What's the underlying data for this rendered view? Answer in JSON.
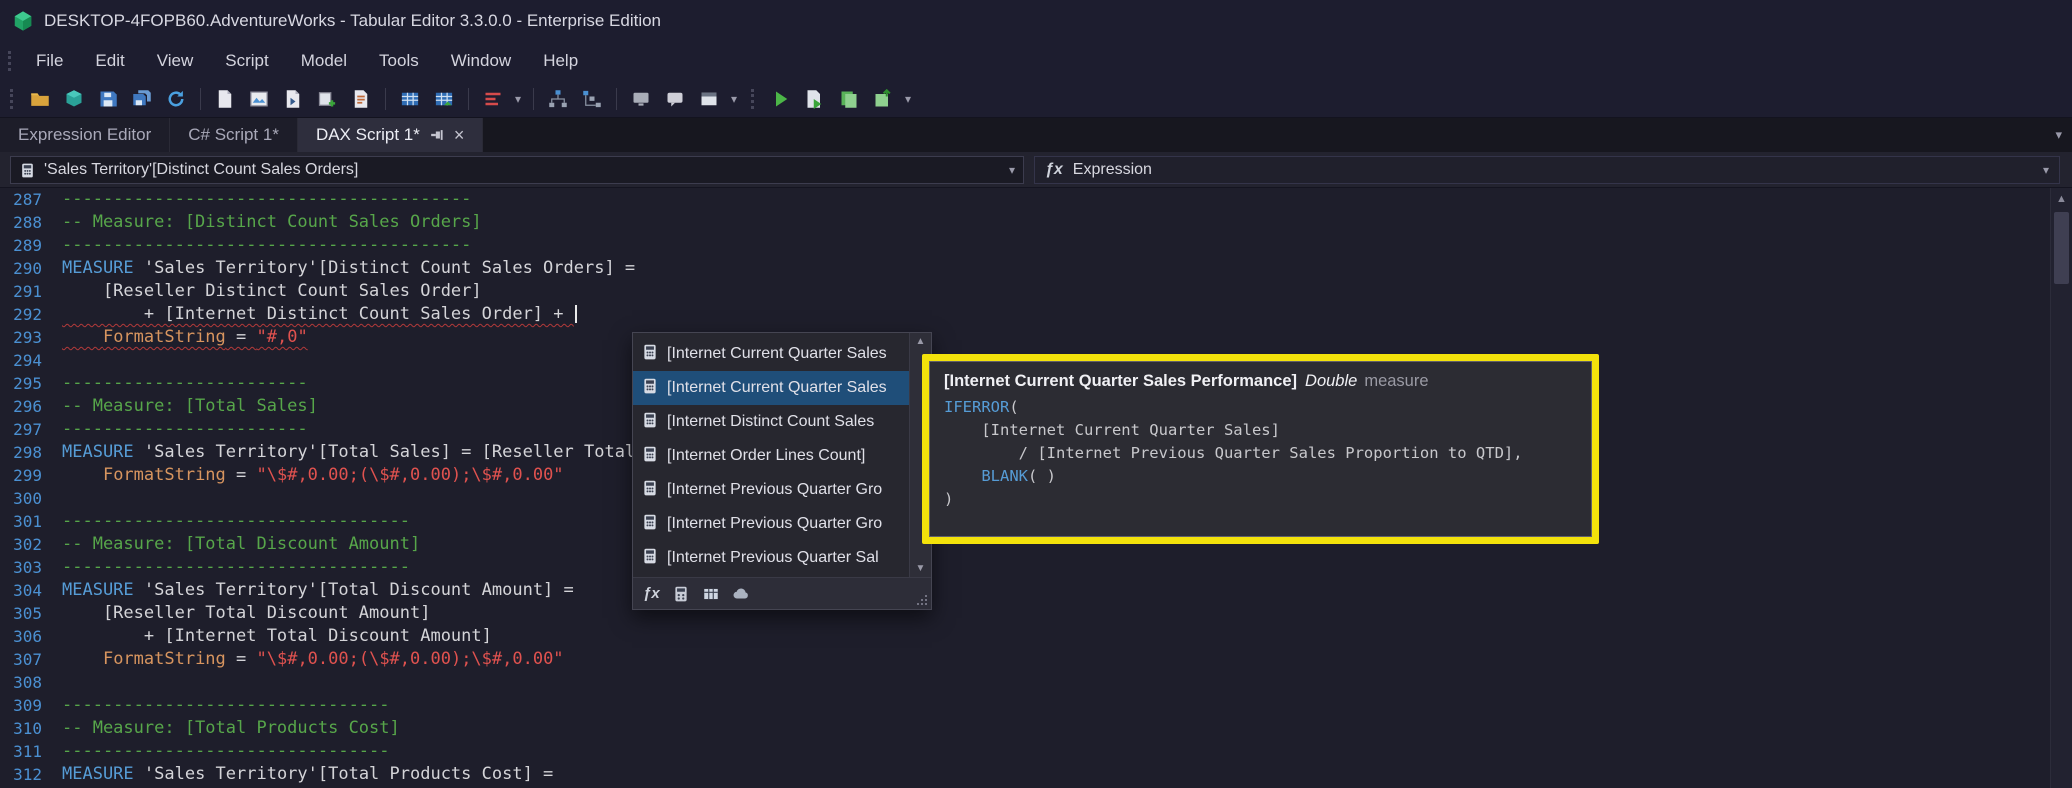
{
  "window": {
    "title": "DESKTOP-4FOPB60.AdventureWorks - Tabular Editor 3.3.0.0 - Enterprise Edition"
  },
  "menu": {
    "items": [
      "File",
      "Edit",
      "View",
      "Script",
      "Model",
      "Tools",
      "Window",
      "Help"
    ]
  },
  "toolbar": {
    "icons": [
      "folder-open",
      "model-cube",
      "save",
      "save-all",
      "refresh",
      "new-script",
      "diagram",
      "dax-query",
      "new-measure",
      "macro-script",
      "import-table",
      "export-table",
      "format-dax",
      "dependencies",
      "hierarchy",
      "screen",
      "comment",
      "window-layout",
      "run",
      "run-script",
      "deploy",
      "publish"
    ]
  },
  "tabs": [
    {
      "label": "Expression Editor",
      "active": false
    },
    {
      "label": "C# Script 1*",
      "active": false
    },
    {
      "label": "DAX Script 1*",
      "active": true
    }
  ],
  "expression_bar": {
    "selected_measure": "'Sales Territory'[Distinct Count Sales Orders]",
    "right_label": "Expression"
  },
  "editor": {
    "lines": [
      {
        "num": 287,
        "seg": [
          {
            "c": "cm",
            "t": "----------------------------------------"
          }
        ]
      },
      {
        "num": 288,
        "seg": [
          {
            "c": "cm",
            "t": "-- Measure: [Distinct Count Sales Orders]"
          }
        ]
      },
      {
        "num": 289,
        "seg": [
          {
            "c": "cm",
            "t": "----------------------------------------"
          }
        ]
      },
      {
        "num": 290,
        "seg": [
          {
            "c": "kw",
            "t": "MEASURE"
          },
          {
            "c": "pl",
            "t": " 'Sales Territory'[Distinct Count Sales Orders] ="
          }
        ]
      },
      {
        "num": 291,
        "seg": [
          {
            "c": "pl",
            "t": "    [Reseller Distinct Count Sales Order]"
          }
        ]
      },
      {
        "num": 292,
        "err": true,
        "seg": [
          {
            "c": "pl",
            "t": "        + [Internet Distinct Count Sales Order] + "
          },
          {
            "c": "caret",
            "t": ""
          }
        ]
      },
      {
        "num": 293,
        "err": true,
        "seg": [
          {
            "c": "pl",
            "t": "    "
          },
          {
            "c": "fs",
            "t": "FormatString"
          },
          {
            "c": "pl",
            "t": " = "
          },
          {
            "c": "st",
            "t": "\"#,0\""
          }
        ]
      },
      {
        "num": 294,
        "seg": []
      },
      {
        "num": 295,
        "seg": [
          {
            "c": "cm",
            "t": "------------------------"
          }
        ]
      },
      {
        "num": 296,
        "seg": [
          {
            "c": "cm",
            "t": "-- Measure: [Total Sales]"
          }
        ]
      },
      {
        "num": 297,
        "seg": [
          {
            "c": "cm",
            "t": "------------------------"
          }
        ]
      },
      {
        "num": 298,
        "seg": [
          {
            "c": "kw",
            "t": "MEASURE"
          },
          {
            "c": "pl",
            "t": " 'Sales Territory'[Total Sales] = [Reseller Total"
          }
        ]
      },
      {
        "num": 299,
        "seg": [
          {
            "c": "pl",
            "t": "    "
          },
          {
            "c": "fs",
            "t": "FormatString"
          },
          {
            "c": "pl",
            "t": " = "
          },
          {
            "c": "st",
            "t": "\"\\$#,0.00;(\\$#,0.00);\\$#,0.00\""
          }
        ]
      },
      {
        "num": 300,
        "seg": []
      },
      {
        "num": 301,
        "seg": [
          {
            "c": "cm",
            "t": "----------------------------------"
          }
        ]
      },
      {
        "num": 302,
        "seg": [
          {
            "c": "cm",
            "t": "-- Measure: [Total Discount Amount]"
          }
        ]
      },
      {
        "num": 303,
        "seg": [
          {
            "c": "cm",
            "t": "----------------------------------"
          }
        ]
      },
      {
        "num": 304,
        "seg": [
          {
            "c": "kw",
            "t": "MEASURE"
          },
          {
            "c": "pl",
            "t": " 'Sales Territory'[Total Discount Amount] ="
          }
        ]
      },
      {
        "num": 305,
        "seg": [
          {
            "c": "pl",
            "t": "    [Reseller Total Discount Amount]"
          }
        ]
      },
      {
        "num": 306,
        "seg": [
          {
            "c": "pl",
            "t": "        + [Internet Total Discount Amount]"
          }
        ]
      },
      {
        "num": 307,
        "seg": [
          {
            "c": "pl",
            "t": "    "
          },
          {
            "c": "fs",
            "t": "FormatString"
          },
          {
            "c": "pl",
            "t": " = "
          },
          {
            "c": "st",
            "t": "\"\\$#,0.00;(\\$#,0.00);\\$#,0.00\""
          }
        ]
      },
      {
        "num": 308,
        "seg": []
      },
      {
        "num": 309,
        "seg": [
          {
            "c": "cm",
            "t": "--------------------------------"
          }
        ]
      },
      {
        "num": 310,
        "seg": [
          {
            "c": "cm",
            "t": "-- Measure: [Total Products Cost]"
          }
        ]
      },
      {
        "num": 311,
        "seg": [
          {
            "c": "cm",
            "t": "--------------------------------"
          }
        ]
      },
      {
        "num": 312,
        "seg": [
          {
            "c": "kw",
            "t": "MEASURE"
          },
          {
            "c": "pl",
            "t": " 'Sales Territory'[Total Products Cost] ="
          }
        ]
      }
    ]
  },
  "autocomplete": {
    "items": [
      {
        "label": "[Internet Current Quarter Sales",
        "selected": false
      },
      {
        "label": "[Internet Current Quarter Sales",
        "selected": true
      },
      {
        "label": "[Internet Distinct Count Sales",
        "selected": false
      },
      {
        "label": "[Internet Order Lines Count]",
        "selected": false
      },
      {
        "label": "[Internet Previous Quarter Gro",
        "selected": false
      },
      {
        "label": "[Internet Previous Quarter Gro",
        "selected": false
      },
      {
        "label": "[Internet Previous Quarter Sal",
        "selected": false
      }
    ],
    "footer_icons": [
      "functions-filter",
      "measures-filter",
      "columns-filter",
      "tables-filter"
    ]
  },
  "tooltip": {
    "title": "[Internet Current Quarter Sales Performance]",
    "type": "Double",
    "kind": "measure",
    "lines": [
      [
        {
          "c": "kw",
          "t": "IFERROR"
        },
        {
          "c": "pl",
          "t": "("
        }
      ],
      [
        {
          "c": "pl",
          "t": "    [Internet Current Quarter Sales]"
        }
      ],
      [
        {
          "c": "pl",
          "t": "        / [Internet Previous Quarter Sales Proportion to QTD],"
        }
      ],
      [
        {
          "c": "pl",
          "t": "    "
        },
        {
          "c": "kw",
          "t": "BLANK"
        },
        {
          "c": "pl",
          "t": "( )"
        }
      ],
      [
        {
          "c": "pl",
          "t": ")"
        }
      ]
    ]
  },
  "colors": {
    "selection_blue": "#1f4e79",
    "highlight_yellow": "#f3e20b",
    "comment_green": "#57a64a",
    "keyword_blue": "#569cd6",
    "string_red": "#e0524f",
    "format_orange": "#d8955f",
    "line_number_blue": "#4b90d2",
    "error_squiggle": "#b33a3a"
  }
}
